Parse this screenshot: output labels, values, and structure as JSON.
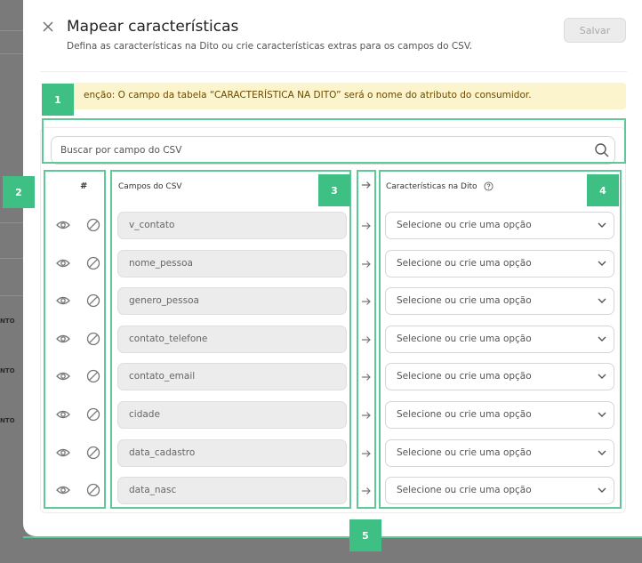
{
  "modal": {
    "title": "Mapear características",
    "subtitle": "Defina as características na Dito ou crie características extras para os campos do CSV.",
    "save_label": "Salvar"
  },
  "alert": {
    "text": "enção: O campo da tabela “CARACTERÍSTICA NA DITO” será o nome do atributo do consumidor."
  },
  "search": {
    "placeholder": "Buscar por campo do CSV"
  },
  "table": {
    "col_hash": "#",
    "col_csv": "Campos do CSV",
    "col_dito": "Características na Dito",
    "select_placeholder": "Selecione ou crie uma opção",
    "rows": [
      {
        "field": "v_contato"
      },
      {
        "field": "nome_pessoa"
      },
      {
        "field": "genero_pessoa"
      },
      {
        "field": "contato_telefone"
      },
      {
        "field": "contato_email"
      },
      {
        "field": "cidade"
      },
      {
        "field": "data_cadastro"
      },
      {
        "field": "data_nasc"
      }
    ]
  },
  "background": {
    "labels": [
      "NTO",
      "NTO",
      "NTO"
    ]
  },
  "annotations": {
    "badges": [
      "1",
      "2",
      "3",
      "4",
      "5"
    ],
    "color": "#3ebf83"
  },
  "colors": {
    "alert_bg": "#fcf4cc",
    "annotation": "#5fc896"
  }
}
